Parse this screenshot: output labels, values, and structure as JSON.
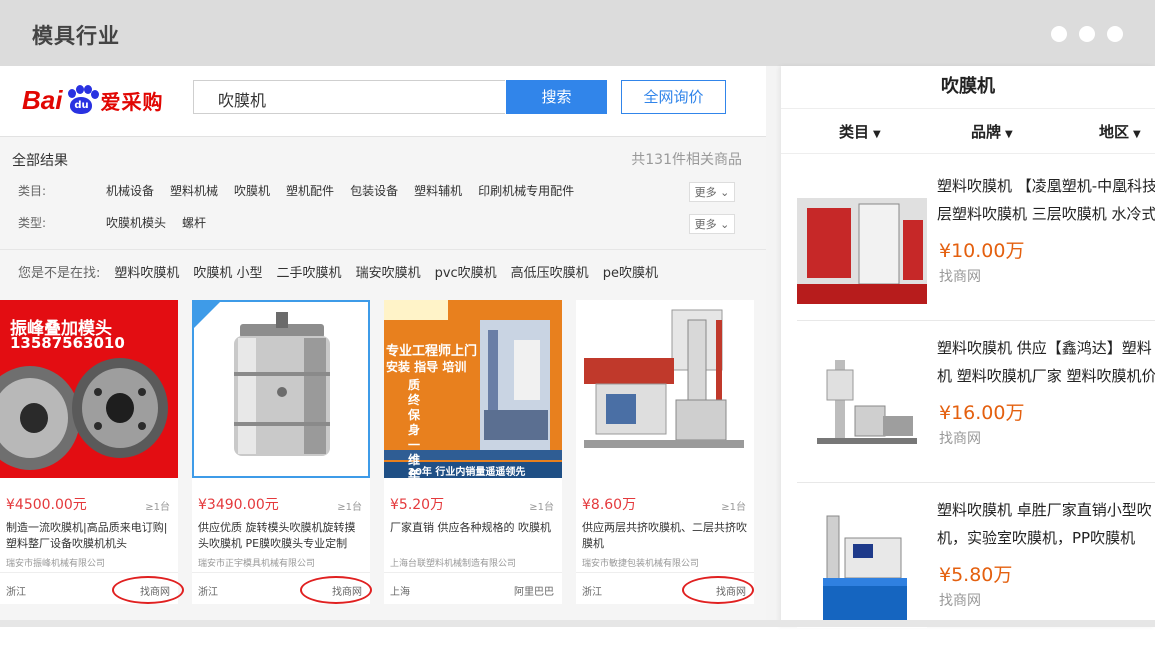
{
  "window": {
    "title": "模具行业"
  },
  "left": {
    "logo": {
      "brand_latin": "Bai",
      "brand_paw": "du",
      "brand_cn": "爱采购"
    },
    "search": {
      "value": "吹膜机",
      "button": "搜索",
      "all_web_button": "全网询价"
    },
    "results": {
      "label": "全部结果",
      "count_text": "共131件相关商品"
    },
    "filters": [
      {
        "label": "类目:",
        "options": [
          "机械设备",
          "塑料机械",
          "吹膜机",
          "塑机配件",
          "包装设备",
          "塑料辅机",
          "印刷机械专用配件"
        ],
        "more": "更多"
      },
      {
        "label": "类型:",
        "options": [
          "吹膜机模头",
          "螺杆"
        ],
        "more": "更多"
      }
    ],
    "suggest": {
      "prefix": "您是不是在找:",
      "items": [
        "塑料吹膜机",
        "吹膜机 小型",
        "二手吹膜机",
        "瑞安吹膜机",
        "pvc吹膜机",
        "高低压吹膜机",
        "pe吹膜机"
      ]
    },
    "cards": [
      {
        "img_text1": "振峰叠加模头",
        "img_text2": "13587563010",
        "price": "¥4500.00元",
        "qty": "≥1台",
        "desc": "制造一流吹膜机|高品质来电订购|塑料整厂设备吹膜机机头",
        "company": "瑞安市振峰机械有限公司",
        "location": "浙江",
        "source": "找商网"
      },
      {
        "img_text1": "",
        "img_text2": "",
        "price": "¥3490.00元",
        "qty": "≥1台",
        "desc": "供应优质 旋转模头吹膜机旋转摸头吹膜机 PE膜吹膜头专业定制",
        "company": "瑞安市正宇模具机械有限公司",
        "location": "浙江",
        "source": "找商网"
      },
      {
        "img_text1": "专业工程师上门",
        "img_text2": "安装 指导 培训",
        "img_text3": "质 终 保 身 一 维 年 修",
        "img_text4": "20年 行业内销量遥遥领先",
        "price": "¥5.20万",
        "qty": "≥1台",
        "desc": "厂家直销 供应各种规格的 吹膜机",
        "company": "上海台联塑料机械制造有限公司",
        "location": "上海",
        "source": "阿里巴巴"
      },
      {
        "img_text1": "",
        "img_text2": "",
        "price": "¥8.60万",
        "qty": "≥1台",
        "desc": "供应两层共挤吹膜机、二层共挤吹膜机",
        "company": "瑞安市敏捷包装机械有限公司",
        "location": "浙江",
        "source": "找商网"
      }
    ]
  },
  "right": {
    "title": "吹膜机",
    "tabs": [
      "类目",
      "品牌",
      "地区"
    ],
    "items": [
      {
        "title1": "塑料吹膜机 【凌凰塑机-中凰科技】",
        "title2": "层塑料吹膜机 三层吹膜机 水冷式",
        "price": "¥10.00万",
        "source": "找商网"
      },
      {
        "title1": "塑料吹膜机 供应【鑫鸿达】塑料",
        "title2": "机 塑料吹膜机厂家 塑料吹膜机价",
        "price": "¥16.00万",
        "source": "找商网"
      },
      {
        "title1": "塑料吹膜机 卓胜厂家直销小型吹",
        "title2": "机，实验室吹膜机，PP吹膜机",
        "price": "¥5.80万",
        "source": "找商网"
      }
    ]
  },
  "colors": {
    "accent_blue": "#3185ea",
    "price_red": "#e4393c",
    "price_orange": "#e4600f",
    "highlight_ring": "#e02020"
  }
}
